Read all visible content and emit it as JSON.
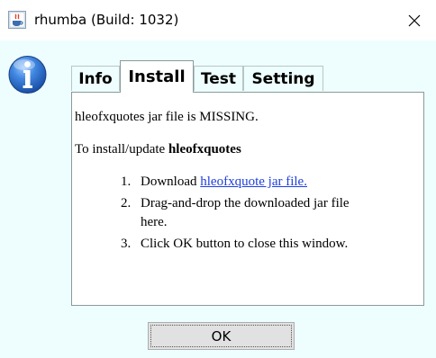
{
  "window": {
    "title": "rhumba (Build: 1032)",
    "app_icon": "java-app-icon",
    "close_icon": "close-icon"
  },
  "dialog": {
    "icon": "info-icon",
    "tabs": [
      {
        "label": "Info",
        "active": false
      },
      {
        "label": "Install",
        "active": true
      },
      {
        "label": "Test",
        "active": false
      },
      {
        "label": "Setting",
        "active": false
      }
    ],
    "install_panel": {
      "status_text": "hleofxquotes jar file is MISSING.",
      "instruction_prefix": "To install/update ",
      "instruction_target": "hleofxquotes",
      "steps": [
        {
          "number": "1.",
          "prefix": "Download ",
          "link_text": "hleofxquote jar file."
        },
        {
          "number": "2.",
          "line1": "Drag-and-drop the downloaded jar file",
          "line2": "here."
        },
        {
          "number": "3.",
          "text": "Click OK button to close this window."
        }
      ]
    },
    "ok_button_label": "OK"
  },
  "colors": {
    "panel_background": "#eefdfd",
    "link": "#1e3fe0",
    "button_face": "#e1e1e1",
    "info_icon_blue": "#2a6fd0"
  }
}
